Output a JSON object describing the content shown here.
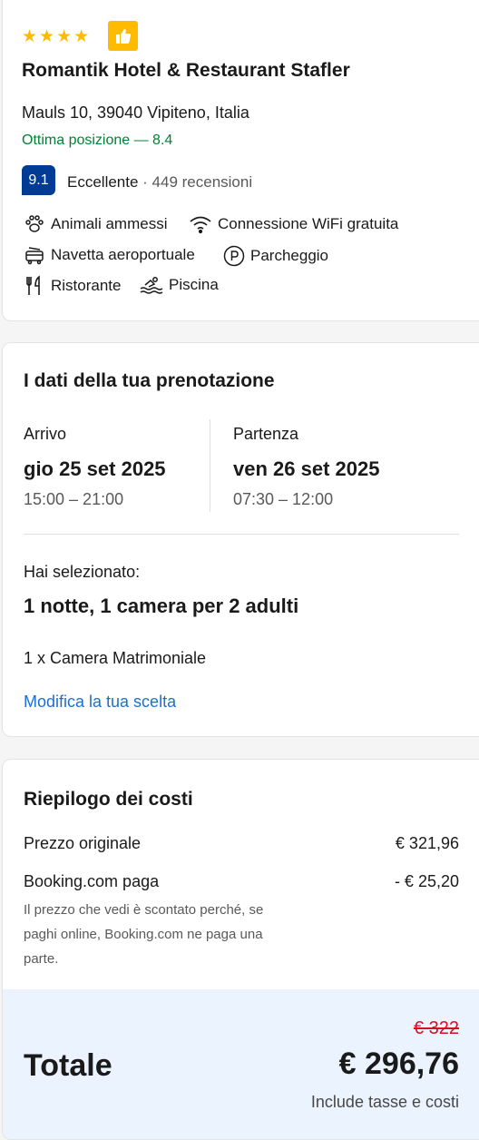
{
  "hotel": {
    "stars": [
      "★",
      "★",
      "★",
      "★"
    ],
    "thumb_icon": "thumbs-up-icon",
    "name": "Romantik Hotel & Restaurant Stafler",
    "address": "Mauls 10, 39040 Vipiteno, Italia",
    "location_score": "Ottima posizione — 8.4",
    "review_score": "9.1",
    "review_word": "Eccellente",
    "review_count": " · 449 recensioni",
    "amenities": [
      {
        "icon": "paw-icon",
        "label": "Animali ammessi"
      },
      {
        "icon": "wifi-icon",
        "label": "Connessione WiFi gratuita"
      },
      {
        "icon": "shuttle-icon",
        "label": "Navetta aeroportuale"
      },
      {
        "icon": "parking-icon",
        "label": "Parcheggio"
      },
      {
        "icon": "restaurant-icon",
        "label": "Ristorante"
      },
      {
        "icon": "pool-icon",
        "label": "Piscina"
      }
    ]
  },
  "booking": {
    "title": "I dati della tua prenotazione",
    "checkin_label": "Arrivo",
    "checkin_date": "gio 25 set 2025",
    "checkin_time": "15:00 – 21:00",
    "checkout_label": "Partenza",
    "checkout_date": "ven 26 set 2025",
    "checkout_time": "07:30 – 12:00",
    "selected_label": "Hai selezionato:",
    "selected_summary": "1 notte, 1 camera per 2 adulti",
    "room": "1 x Camera Matrimoniale",
    "modify_link": "Modifica la tua scelta"
  },
  "costs": {
    "title": "Riepilogo dei costi",
    "original_label": "Prezzo originale",
    "original_value": "€ 321,96",
    "booking_pays_label": "Booking.com paga",
    "booking_pays_value": "- € 25,20",
    "note_line1": "Il prezzo che vedi è scontato perché, se",
    "note_line2": "paghi online, Booking.com ne paga una",
    "note_line3": "parte.",
    "old_total": "€ 322",
    "total_label": "Totale",
    "total_value": "€ 296,76",
    "taxes_note": "Include tasse e costi"
  },
  "colors": {
    "brand_blue": "#003b95",
    "link_blue": "#1a6fd6",
    "green": "#008234",
    "star_yellow": "#febb02",
    "strike_red": "#d4111e",
    "total_bg": "#ebf3ff"
  }
}
